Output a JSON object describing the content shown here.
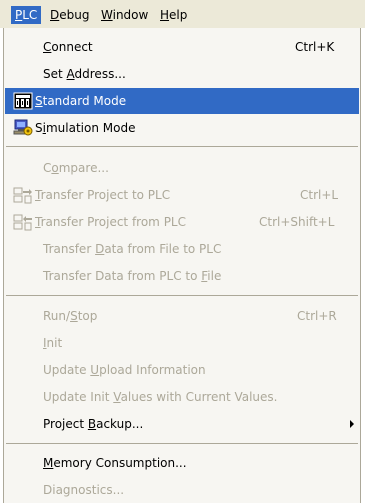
{
  "menubar": {
    "items": [
      {
        "label_pre": "",
        "mn": "P",
        "label_post": "LC"
      },
      {
        "label_pre": "",
        "mn": "D",
        "label_post": "ebug"
      },
      {
        "label_pre": "",
        "mn": "W",
        "label_post": "indow"
      },
      {
        "label_pre": "",
        "mn": "H",
        "label_post": "elp"
      }
    ]
  },
  "menu": {
    "connect": {
      "pre": "",
      "mn": "C",
      "post": "onnect",
      "accel": "Ctrl+K"
    },
    "set_address": {
      "pre": "Set ",
      "mn": "A",
      "post": "ddress..."
    },
    "standard_mode": {
      "pre": "",
      "mn": "S",
      "post": "tandard Mode",
      "icon": "standard-mode-icon"
    },
    "simulation_mode": {
      "pre": "S",
      "mn": "i",
      "post": "mulation Mode",
      "icon": "simulation-mode-icon"
    },
    "compare": {
      "pre": "C",
      "mn": "o",
      "post": "mpare..."
    },
    "transfer_to_plc": {
      "pre": "",
      "mn": "T",
      "post": "ransfer Project to PLC",
      "accel": "Ctrl+L",
      "icon": "transfer-to-plc-icon"
    },
    "transfer_from_plc": {
      "pre": "",
      "mn": "T",
      "post": "ransfer Project from PLC",
      "accel": "Ctrl+Shift+L",
      "icon": "transfer-from-plc-icon"
    },
    "transfer_data_from_file": {
      "pre": "Transfer ",
      "mn": "D",
      "post": "ata from File to PLC"
    },
    "transfer_data_to_file": {
      "pre": "Transfer Data from PLC to ",
      "mn": "F",
      "post": "ile"
    },
    "run_stop": {
      "pre": "Run/",
      "mn": "S",
      "post": "top",
      "accel": "Ctrl+R"
    },
    "init": {
      "pre": "",
      "mn": "I",
      "post": "nit"
    },
    "update_upload": {
      "pre": "Update ",
      "mn": "U",
      "post": "pload Information"
    },
    "update_init": {
      "pre": "Update Init ",
      "mn": "V",
      "post": "alues with Current Values."
    },
    "project_backup": {
      "pre": "Project ",
      "mn": "B",
      "post": "ackup..."
    },
    "memory_consumption": {
      "pre": "",
      "mn": "M",
      "post": "emory Consumption..."
    },
    "diagnostics": {
      "pre": "Diagnostics...",
      "mn": "",
      "post": ""
    }
  },
  "colors": {
    "highlight": "#316ac5",
    "disabled_text": "#aca899",
    "menu_bg": "#f7f6f2",
    "menubar_bg": "#ece9d8"
  }
}
